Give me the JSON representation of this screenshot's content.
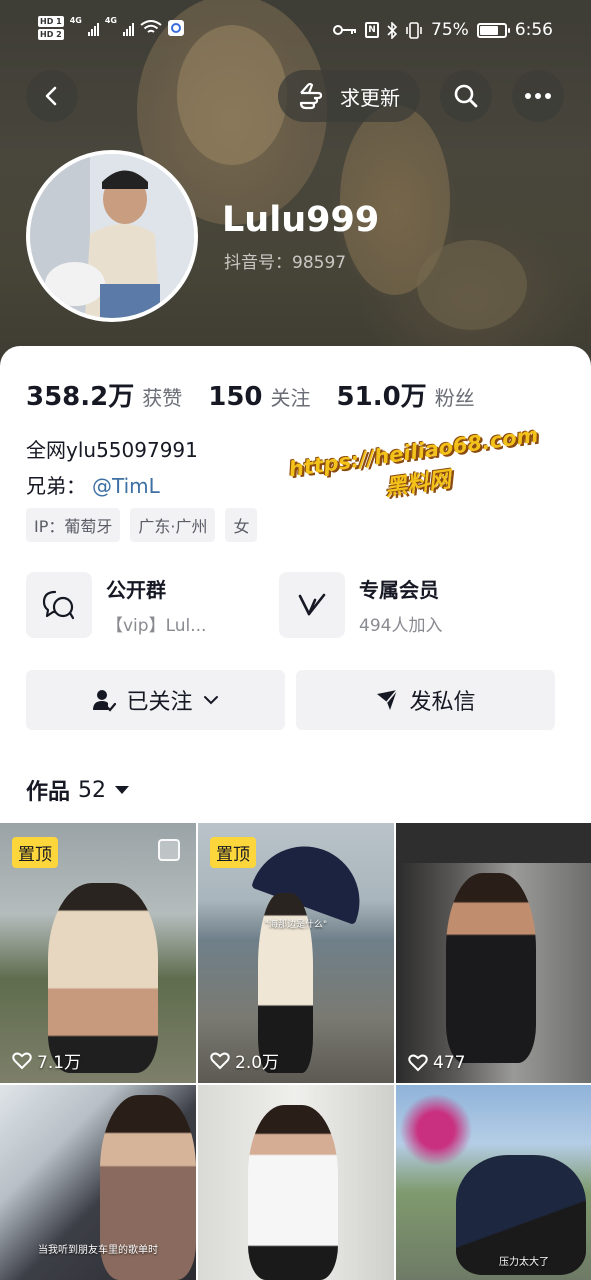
{
  "status_bar": {
    "hd1": "HD 1",
    "hd2": "HD 2",
    "net1": "4G",
    "net2": "4G",
    "battery_percent": "75%",
    "battery_level": 0.75,
    "time": "6:56"
  },
  "header": {
    "update_label": "求更新",
    "username": "Lulu999",
    "douyin_id": "抖音号：98597"
  },
  "stats": [
    {
      "value": "358.2万",
      "label": "获赞"
    },
    {
      "value": "150",
      "label": "关注"
    },
    {
      "value": "51.0万",
      "label": "粉丝"
    }
  ],
  "bio": {
    "line1": "全网ylu55097991",
    "line2_prefix": "兄弟：",
    "mention": "@TimL"
  },
  "tags": [
    "IP：葡萄牙",
    "广东·广州",
    "女"
  ],
  "watermark": {
    "url": "https://heiliao68.com",
    "name": "黑料网"
  },
  "features": {
    "group": {
      "title": "公开群",
      "subtitle": "【vip】Lul..."
    },
    "member": {
      "title": "专属会员",
      "subtitle": "494人加入"
    }
  },
  "actions": {
    "follow": "已关注",
    "message": "发私信"
  },
  "works": {
    "label": "作品",
    "count": "52"
  },
  "videos": [
    {
      "pinned": "置顶",
      "likes": "7.1万",
      "caption": ""
    },
    {
      "pinned": "置顶",
      "likes": "2.0万",
      "caption": "\"海那边是什么\""
    },
    {
      "pinned": "",
      "likes": "477",
      "caption": ""
    },
    {
      "pinned": "",
      "likes": "",
      "caption": "当我听到朋友车里的歌单时"
    },
    {
      "pinned": "",
      "likes": "",
      "caption": ""
    },
    {
      "pinned": "",
      "likes": "",
      "caption": "压力太大了"
    }
  ],
  "colors": {
    "mention": "#3d6fa3",
    "pin_badge": "#fcd63b",
    "watermark": "#f2c21a"
  }
}
